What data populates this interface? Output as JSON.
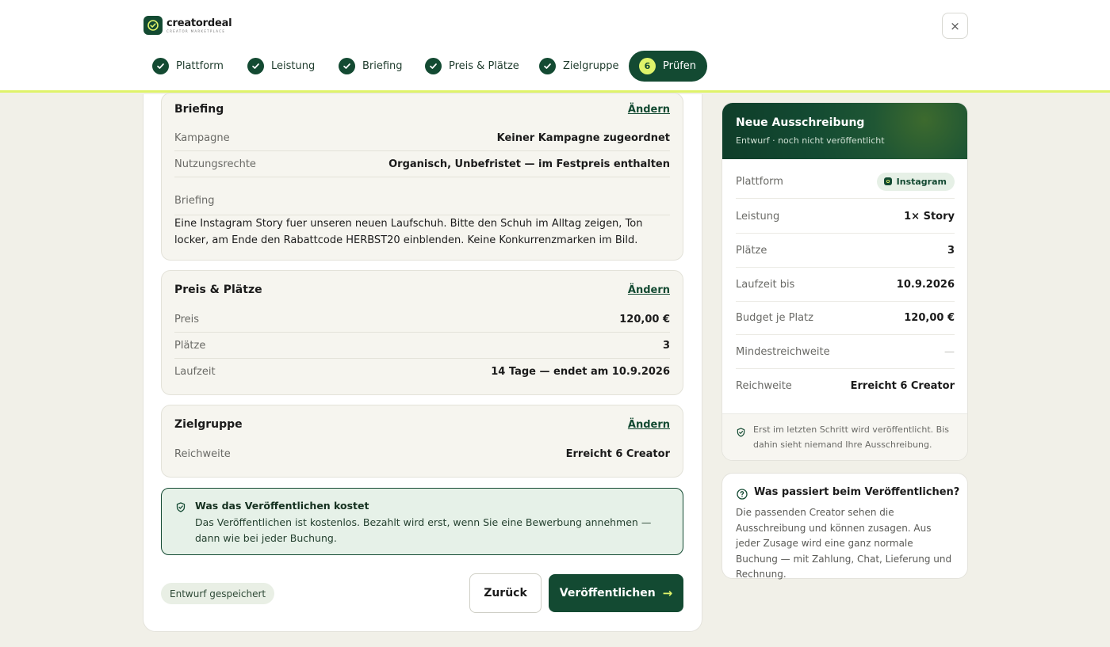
{
  "brand": {
    "name": "creatordeal",
    "tagline": "CREATOR MARKETPLACE"
  },
  "steps": [
    {
      "label": "Plattform"
    },
    {
      "label": "Leistung"
    },
    {
      "label": "Briefing"
    },
    {
      "label": "Preis & Plätze"
    },
    {
      "label": "Zielgruppe"
    },
    {
      "number": "6",
      "label": "Prüfen"
    }
  ],
  "close_label": "×",
  "edit_label": "Ändern",
  "briefing": {
    "title": "Briefing",
    "rows": [
      {
        "label": "Kampagne",
        "value": "Keiner Kampagne zugeordnet"
      },
      {
        "label": "Nutzungsrechte",
        "value": "Organisch, Unbefristet — im Festpreis enthalten"
      }
    ],
    "text_label": "Briefing",
    "text": "Eine Instagram Story fuer unseren neuen Laufschuh. Bitte den Schuh im Alltag zeigen, Ton locker, am Ende den Rabattcode HERBST20 einblenden. Keine Konkurrenzmarken im Bild."
  },
  "pricing": {
    "title": "Preis & Plätze",
    "rows": [
      {
        "label": "Preis",
        "value": "120,00 €"
      },
      {
        "label": "Plätze",
        "value": "3"
      },
      {
        "label": "Laufzeit",
        "value": "14 Tage — endet am 10.9.2026"
      }
    ]
  },
  "audience": {
    "title": "Zielgruppe",
    "rows": [
      {
        "label": "Reichweite",
        "value": "Erreicht 6 Creator"
      }
    ]
  },
  "cost_info": {
    "title": "Was das Veröffentlichen kostet",
    "text": "Das Veröffentlichen ist kostenlos. Bezahlt wird erst, wenn Sie eine Bewerbung annehmen — dann wie bei jeder Buchung."
  },
  "footer": {
    "draft_status": "Entwurf gespeichert",
    "back_label": "Zurück",
    "publish_label": "Veröffentlichen"
  },
  "summary": {
    "title": "Neue Ausschreibung",
    "subtitle": "Entwurf · noch nicht veröffentlicht",
    "platform_label": "Plattform",
    "platform_value": "Instagram",
    "rows": [
      {
        "label": "Leistung",
        "value": "1× Story"
      },
      {
        "label": "Plätze",
        "value": "3"
      },
      {
        "label": "Laufzeit bis",
        "value": "10.9.2026"
      },
      {
        "label": "Budget je Platz",
        "value": "120,00 €"
      },
      {
        "label": "Mindestreichweite",
        "value": "—"
      },
      {
        "label": "Reichweite",
        "value": "Erreicht 6 Creator"
      }
    ],
    "note": "Erst im letzten Schritt wird veröffentlicht. Bis dahin sieht niemand Ihre Ausschreibung."
  },
  "help": {
    "title": "Was passiert beim Veröffentlichen?",
    "text": "Die passenden Creator sehen die Ausschreibung und können zusagen. Aus jeder Zusage wird eine ganz normale Buchung — mit Zahlung, Chat, Lieferung und Rechnung."
  },
  "colors": {
    "brand": "#134a32",
    "accent": "#dff36a",
    "background": "#f1f0e8"
  }
}
